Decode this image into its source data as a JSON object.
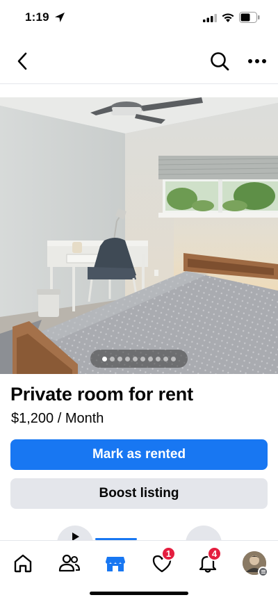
{
  "status_bar": {
    "time": "1:19",
    "icons": [
      "location-arrow-icon",
      "signal-icon",
      "wifi-icon",
      "battery-icon"
    ]
  },
  "nav": {
    "icons": [
      "back-chevron-icon",
      "search-icon",
      "more-dots-icon"
    ]
  },
  "photo": {
    "carousel_total": 10,
    "carousel_active_index": 0
  },
  "listing": {
    "title": "Private room for rent",
    "price": "$1,200 / Month"
  },
  "actions": {
    "primary_label": "Mark as rented",
    "secondary_label": "Boost listing"
  },
  "tab_bar": {
    "tabs": [
      {
        "name": "home",
        "icon": "home-icon"
      },
      {
        "name": "friends",
        "icon": "friends-icon"
      },
      {
        "name": "marketplace",
        "icon": "marketplace-icon",
        "active": true
      },
      {
        "name": "dating",
        "icon": "heart-shield-icon",
        "badge": "1"
      },
      {
        "name": "notifications",
        "icon": "bell-icon",
        "badge": "4"
      },
      {
        "name": "profile",
        "icon": "avatar-icon"
      }
    ]
  },
  "colors": {
    "accent": "#1877f2",
    "secondary_button": "#e4e6eb",
    "badge": "#e41e3f",
    "text": "#050505"
  }
}
